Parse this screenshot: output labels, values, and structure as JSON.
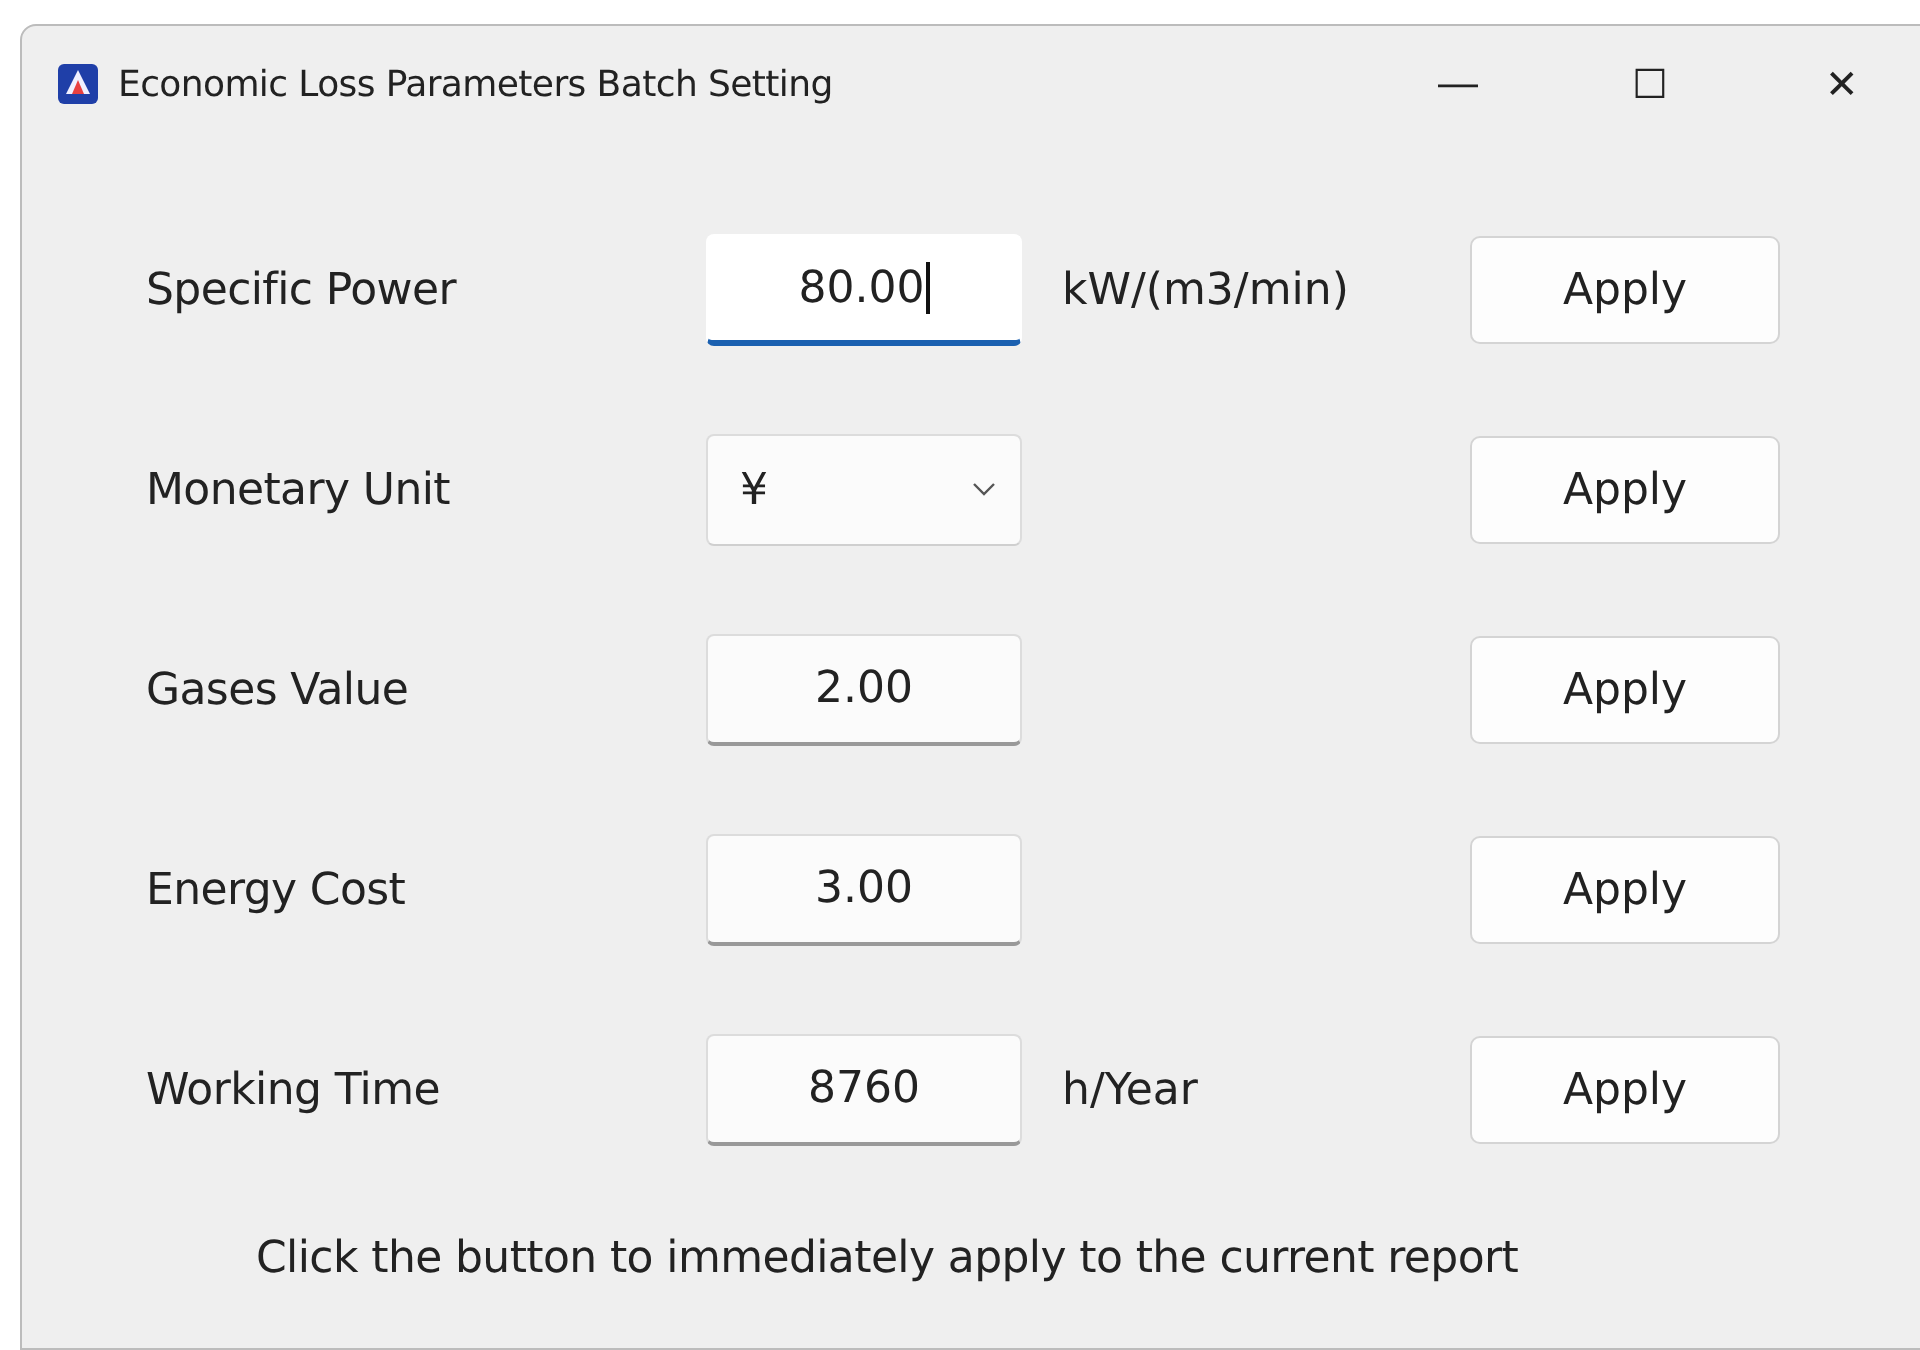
{
  "window": {
    "title": "Economic Loss Parameters Batch Setting",
    "controls": [
      "—",
      "☐",
      "✕"
    ]
  },
  "rows": [
    {
      "label": "Specific Power",
      "field": {
        "kind": "text",
        "value": "80.00",
        "focused": true
      },
      "unit": "kW/(m3/min)",
      "button": "Apply"
    },
    {
      "label": "Monetary Unit",
      "field": {
        "kind": "dropdown",
        "value": "¥",
        "focused": false
      },
      "button": "Apply"
    },
    {
      "label": "Gases Value",
      "field": {
        "kind": "text",
        "value": "2.00",
        "focused": false
      },
      "button": "Apply"
    },
    {
      "label": "Energy Cost",
      "field": {
        "kind": "text",
        "value": "3.00",
        "focused": false
      },
      "button": "Apply"
    },
    {
      "label": "Working Time",
      "field": {
        "kind": "text",
        "value": "8760",
        "focused": false
      },
      "unit": "h/Year",
      "button": "Apply"
    }
  ],
  "footer": "Click the button to immediately apply to the current report"
}
